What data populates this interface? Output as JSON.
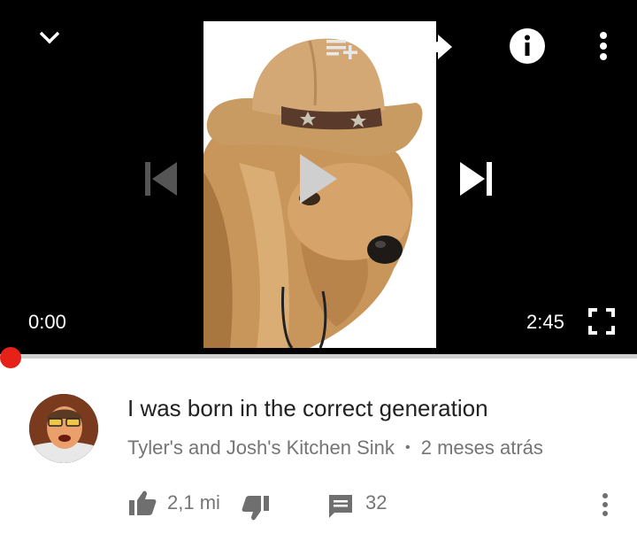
{
  "player": {
    "current_time": "0:00",
    "duration": "2:45",
    "progress": 0
  },
  "video": {
    "title": "I was born in the correct generation",
    "channel": "Tyler's and Josh's Kitchen Sink",
    "separator": "•",
    "age": "2 meses atrás"
  },
  "actions": {
    "likes": "2,1 mi",
    "comments": "32"
  },
  "icons": {
    "top_left": "chevron-down-icon",
    "add_to_queue": "add-to-queue-icon",
    "share": "share-icon",
    "info": "info-icon",
    "more": "more-vertical-icon",
    "previous": "skip-previous-icon",
    "play": "play-icon",
    "next": "skip-next-icon",
    "fullscreen": "fullscreen-icon",
    "like": "thumbs-up-icon",
    "dislike": "thumbs-down-icon",
    "comment": "comment-icon"
  },
  "colors": {
    "progress_dot": "#e62117",
    "player_bg": "#000000"
  }
}
